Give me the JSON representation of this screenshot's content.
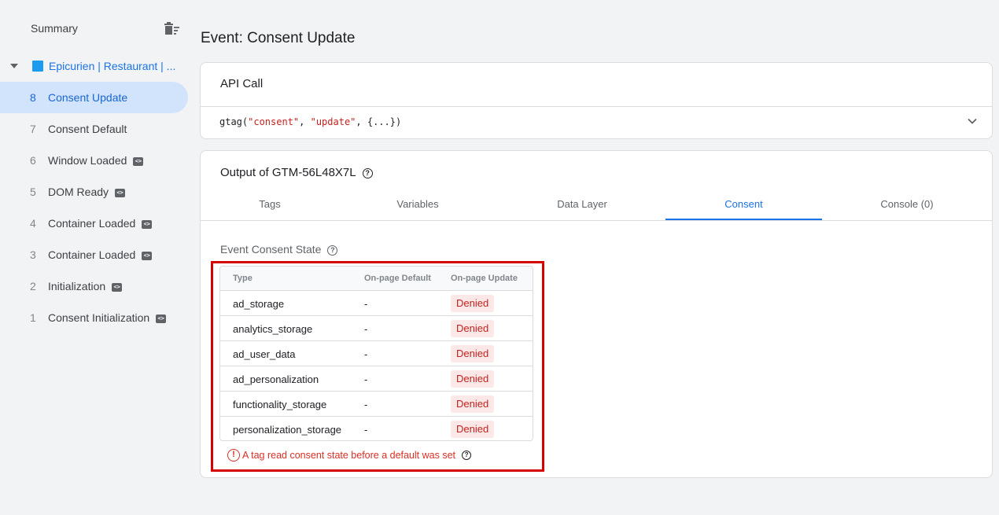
{
  "sidebar": {
    "summary_label": "Summary",
    "container_label": "Epicurien | Restaurant | ...",
    "container_color": "#1a9bf0",
    "events": [
      {
        "num": "8",
        "label": "Consent Update",
        "active": true,
        "code_icon": false
      },
      {
        "num": "7",
        "label": "Consent Default",
        "active": false,
        "code_icon": false
      },
      {
        "num": "6",
        "label": "Window Loaded",
        "active": false,
        "code_icon": true
      },
      {
        "num": "5",
        "label": "DOM Ready",
        "active": false,
        "code_icon": true
      },
      {
        "num": "4",
        "label": "Container Loaded",
        "active": false,
        "code_icon": true
      },
      {
        "num": "3",
        "label": "Container Loaded",
        "active": false,
        "code_icon": true
      },
      {
        "num": "2",
        "label": "Initialization",
        "active": false,
        "code_icon": true
      },
      {
        "num": "1",
        "label": "Consent Initialization",
        "active": false,
        "code_icon": true
      }
    ]
  },
  "main": {
    "title": "Event: Consent Update",
    "api_card": {
      "title": "API Call",
      "code_prefix": "gtag(",
      "code_arg1": "\"consent\"",
      "code_sep": ", ",
      "code_arg2": "\"update\"",
      "code_suffix": ", {...})"
    },
    "output_card": {
      "title": "Output of GTM-56L48X7L",
      "tabs": [
        "Tags",
        "Variables",
        "Data Layer",
        "Consent",
        "Console (0)"
      ],
      "active_tab": "Consent",
      "section_label": "Event Consent State",
      "table": {
        "headers": [
          "Type",
          "On-page Default",
          "On-page Update"
        ],
        "rows": [
          {
            "type": "ad_storage",
            "default": "-",
            "update": "Denied"
          },
          {
            "type": "analytics_storage",
            "default": "-",
            "update": "Denied"
          },
          {
            "type": "ad_user_data",
            "default": "-",
            "update": "Denied"
          },
          {
            "type": "ad_personalization",
            "default": "-",
            "update": "Denied"
          },
          {
            "type": "functionality_storage",
            "default": "-",
            "update": "Denied"
          },
          {
            "type": "personalization_storage",
            "default": "-",
            "update": "Denied"
          }
        ]
      },
      "warning": "A tag read consent state before a default was set"
    }
  },
  "colors": {
    "accent": "#1a73e8",
    "denied_bg": "#fce8e6",
    "denied_text": "#c5221f",
    "highlight": "#d50000"
  },
  "icons": {
    "clear": "trash-icon",
    "expand": "chevron-down-icon",
    "help": "help-circle-icon",
    "warning": "error-circle-icon",
    "tag": "code-icon"
  }
}
